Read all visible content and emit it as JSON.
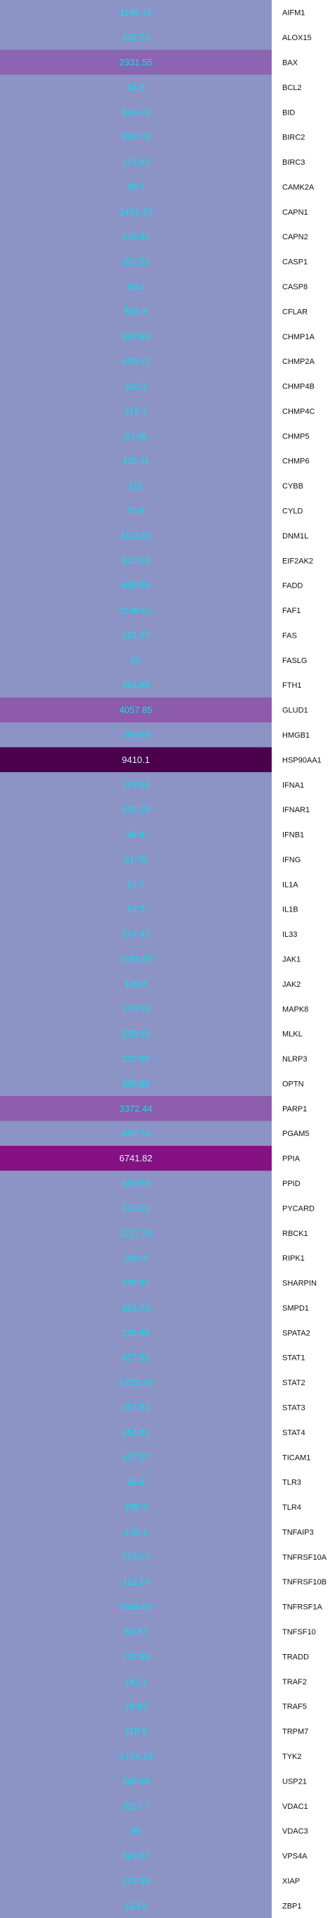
{
  "chart_data": {
    "type": "heatmap",
    "title": "",
    "xlabel": "",
    "ylabel": "",
    "columns": 1,
    "rows": [
      "AIFM1",
      "ALOX15",
      "BAX",
      "BCL2",
      "BID",
      "BIRC2",
      "BIRC3",
      "CAMK2A",
      "CAPN1",
      "CAPN2",
      "CASP1",
      "CASP8",
      "CFLAR",
      "CHMP1A",
      "CHMP2A",
      "CHMP4B",
      "CHMP4C",
      "CHMP5",
      "CHMP6",
      "CYBB",
      "CYLD",
      "DNM1L",
      "EIF2AK2",
      "FADD",
      "FAF1",
      "FAS",
      "FASLG",
      "FTH1",
      "GLUD1",
      "HMGB1",
      "HSP90AA1",
      "IFNA1",
      "IFNAR1",
      "IFNB1",
      "IFNG",
      "IL1A",
      "IL1B",
      "IL33",
      "JAK1",
      "JAK2",
      "MAPK8",
      "MLKL",
      "NLRP3",
      "OPTN",
      "PARP1",
      "PGAM5",
      "PPIA",
      "PPID",
      "PYCARD",
      "RBCK1",
      "RIPK1",
      "SHARPIN",
      "SMPD1",
      "SPATA2",
      "STAT1",
      "STAT2",
      "STAT3",
      "STAT4",
      "TICAM1",
      "TLR3",
      "TLR4",
      "TNFAIP3",
      "TNFRSF10A",
      "TNFRSF10B",
      "TNFRSF1A",
      "TNFSF10",
      "TRADD",
      "TRAF2",
      "TRAF5",
      "TRPM7",
      "TYK2",
      "USP21",
      "VDAC1",
      "VDAC3",
      "VPS4A",
      "XIAP",
      "ZBP1"
    ],
    "values": [
      "1148.72",
      "342.23",
      "2331.55",
      "94.3",
      "316.76",
      "953.75",
      "171.63",
      "66.7",
      "1451.47",
      "578.31",
      "201.21",
      "66.2",
      "506.3",
      "862.96",
      "449.12",
      "110.3",
      "116.1",
      "87.06",
      "426.11",
      "111",
      "70.8",
      "1112.81",
      "510.04",
      "640.68",
      "1138.61",
      "191.37",
      "67",
      "341.85",
      "4057.85",
      "780.09",
      "9410.1",
      "119.34",
      "542.28",
      "66.9",
      "61.78",
      "67.2",
      "67.3",
      "247.42",
      "1163.28",
      "140.8",
      "129.93",
      "239.95",
      "122.95",
      "688.86",
      "3372.44",
      "659.74",
      "6741.82",
      "160.59",
      "137.01",
      "1127.76",
      "596.4",
      "290.51",
      "351.79",
      "125.86",
      "827.61",
      "1723.76",
      "287.81",
      "164.31",
      "197.07",
      "66.8",
      "108.3",
      "178.1",
      "279.07",
      "112.14",
      "1696.02",
      "60.87",
      "192.96",
      "142.1",
      "79.83",
      "118.9",
      "1774.73",
      "340.09",
      "1017.7",
      "90",
      "324.57",
      "124.39",
      "133.9"
    ],
    "color_scale": {
      "low": "#8c93c5",
      "high": "#4a004a",
      "mid1": "#8e5aab",
      "mid2": "#860f82"
    },
    "cell_text_colors": {
      "light_cells": "#00e6f0",
      "dark_cells": "#d8f2ff"
    },
    "legend": "none",
    "grid": false
  }
}
